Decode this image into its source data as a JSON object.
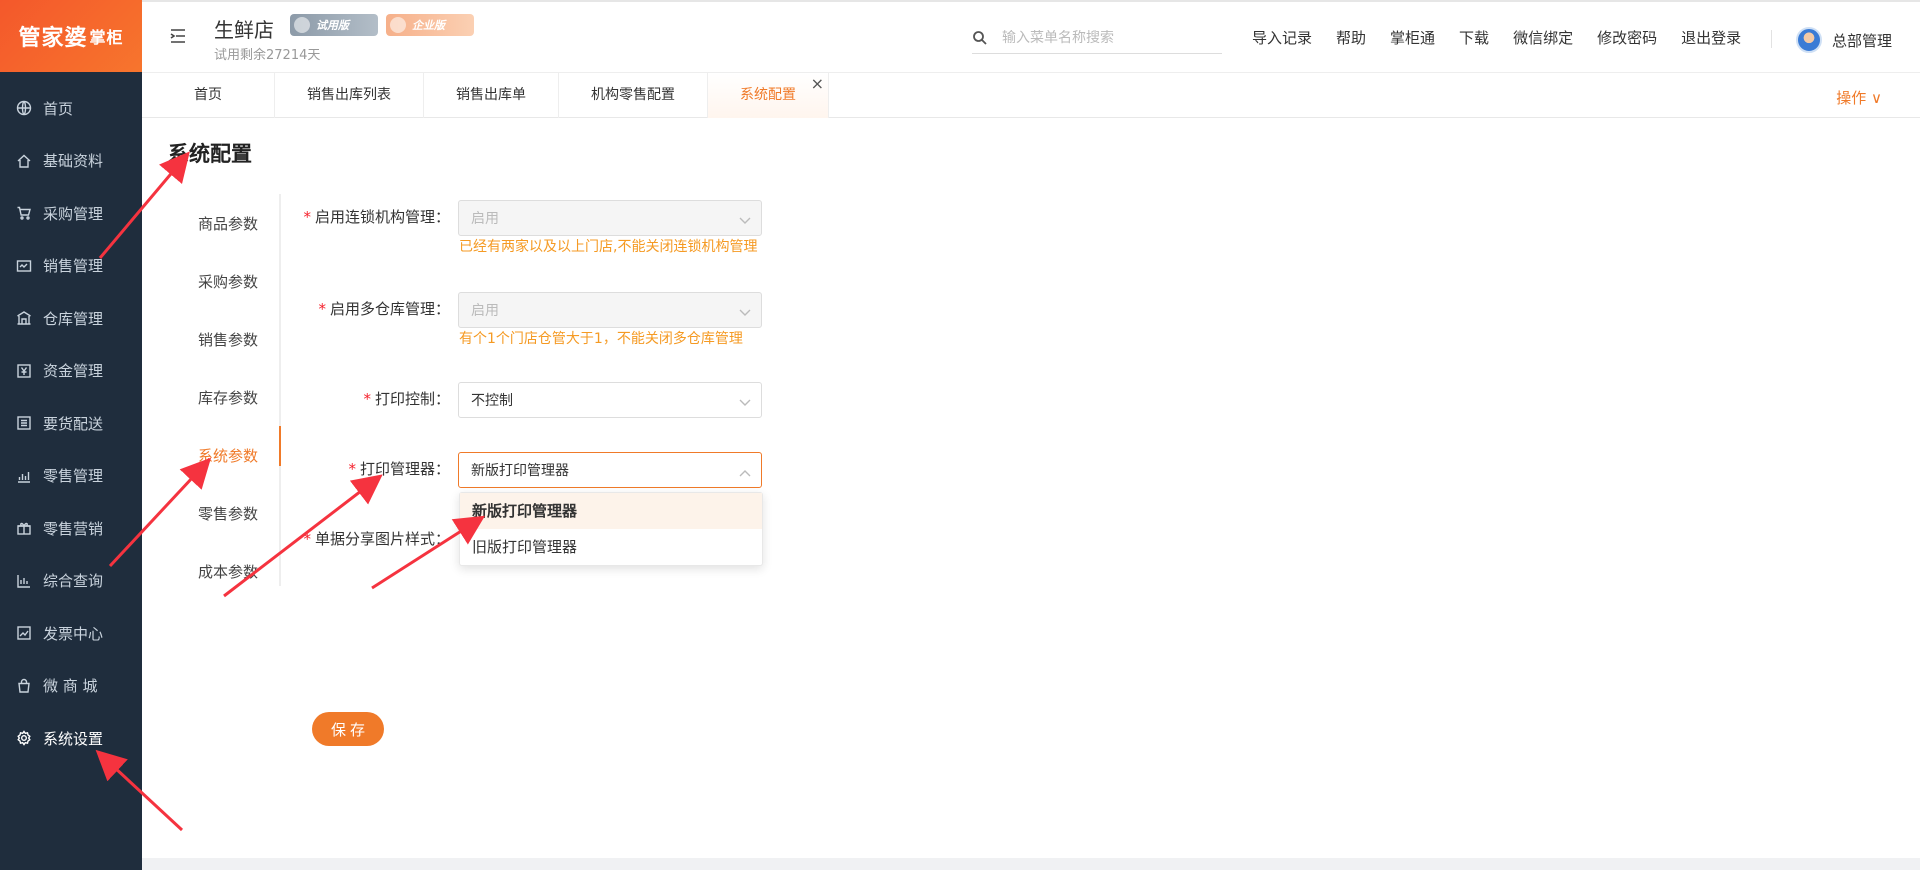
{
  "brand": {
    "logo_main": "管家婆",
    "logo_sub": "掌柜"
  },
  "sidebar": {
    "items": [
      {
        "label": "首页",
        "icon": "globe-icon"
      },
      {
        "label": "基础资料",
        "icon": "home-icon"
      },
      {
        "label": "采购管理",
        "icon": "cart-icon"
      },
      {
        "label": "销售管理",
        "icon": "sales-icon"
      },
      {
        "label": "仓库管理",
        "icon": "warehouse-icon"
      },
      {
        "label": "资金管理",
        "icon": "money-icon"
      },
      {
        "label": "要货配送",
        "icon": "list-icon"
      },
      {
        "label": "零售管理",
        "icon": "chart-icon"
      },
      {
        "label": "零售营销",
        "icon": "gift-icon"
      },
      {
        "label": "综合查询",
        "icon": "bar-chart-icon"
      },
      {
        "label": "发票中心",
        "icon": "trend-icon"
      },
      {
        "label": "微 商 城",
        "icon": "bag-icon"
      },
      {
        "label": "系统设置",
        "icon": "gear-icon"
      }
    ],
    "active": "系统设置"
  },
  "header": {
    "store_name": "生鲜店",
    "trial_badge": "试用版",
    "enterprise_badge": "企业版",
    "trial_left": "试用剩余27214天",
    "search_placeholder": "输入菜单名称搜索",
    "links": [
      "导入记录",
      "帮助",
      "掌柜通",
      "下载",
      "微信绑定",
      "修改密码",
      "退出登录"
    ],
    "user": "总部管理"
  },
  "tabs": {
    "items": [
      "首页",
      "销售出库列表",
      "销售出库单",
      "机构零售配置",
      "系统配置"
    ],
    "active": "系统配置",
    "close_glyph": "×",
    "ops_label": "操作 ∨"
  },
  "page": {
    "title": "系统配置",
    "side_tabs": [
      "商品参数",
      "采购参数",
      "销售参数",
      "库存参数",
      "系统参数",
      "零售参数",
      "成本参数"
    ],
    "active_side_tab": "系统参数",
    "form": {
      "chain": {
        "label": "启用连锁机构管理",
        "value": "启用",
        "hint": "已经有两家以及以上门店,不能关闭连锁机构管理"
      },
      "multi_warehouse": {
        "label": "启用多仓库管理",
        "value": "启用",
        "hint": "有个1个门店仓管大于1，不能关闭多仓库管理"
      },
      "print_control": {
        "label": "打印控制",
        "value": "不控制"
      },
      "print_manager": {
        "label": "打印管理器",
        "value": "新版打印管理器",
        "options": [
          "新版打印管理器",
          "旧版打印管理器"
        ]
      },
      "share_style": {
        "label": "单据分享图片样式"
      }
    },
    "save_label": "保存",
    "required_mark": "*",
    "colon": "："
  },
  "colors": {
    "accent": "#f07a29",
    "sidebar_bg": "#1f2d3d",
    "warning": "#f59a23",
    "annotation": "#f5333f"
  }
}
